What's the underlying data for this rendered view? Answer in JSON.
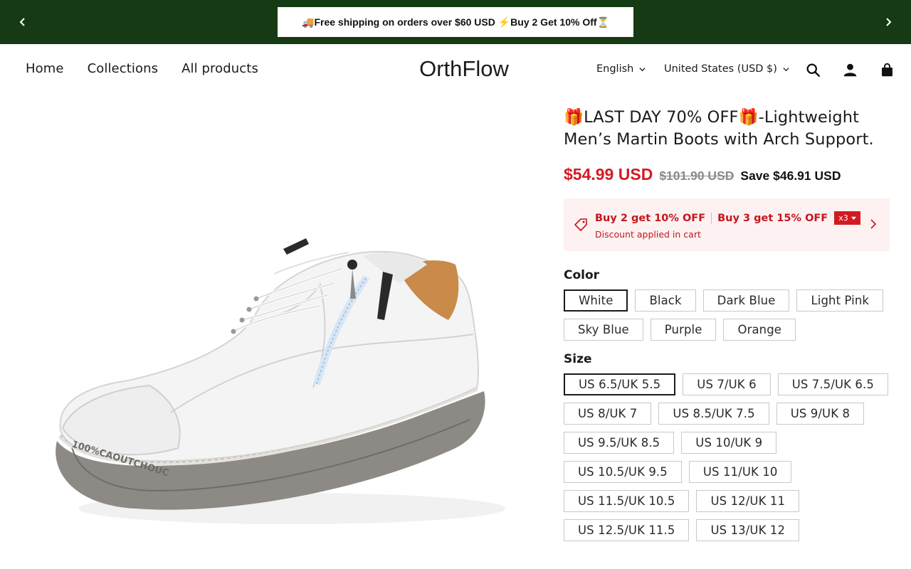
{
  "announcement": {
    "message": "🚚Free shipping on orders over $60 USD ⚡Buy 2 Get 10% Off⏳",
    "prev_icon": "chevron-left-icon",
    "next_icon": "chevron-right-icon",
    "bar_color": "#153a14"
  },
  "header": {
    "nav": [
      "Home",
      "Collections",
      "All products"
    ],
    "logo": "OrthFlow",
    "language": "English",
    "country": "United States (USD $)",
    "icons": [
      "search-icon",
      "account-icon",
      "cart-icon"
    ]
  },
  "product": {
    "title": "🎁LAST DAY 70% OFF🎁-Lightweight Men’s Martin Boots with Arch Support.",
    "price": "$54.99 USD",
    "compare_price": "$101.90 USD",
    "savings": "Save $46.91 USD",
    "promo": {
      "offer_1": "Buy 2 get 10% OFF",
      "offer_2": "Buy 3 get 15% OFF",
      "quantity_badge": "x3",
      "note": "Discount applied in cart"
    },
    "color_label": "Color",
    "colors": [
      "White",
      "Black",
      "Dark Blue",
      "Light Pink",
      "Sky Blue",
      "Purple",
      "Orange"
    ],
    "selected_color": "White",
    "size_label": "Size",
    "sizes": [
      "US 6.5/UK 5.5",
      "US 7/UK 6",
      "US 7.5/UK 6.5",
      "US 8/UK 7",
      "US 8.5/UK 7.5",
      "US 9/UK 8",
      "US 9.5/UK 8.5",
      "US 10/UK 9",
      "US 10.5/UK 9.5",
      "US 11/UK 10",
      "US 11.5/UK 10.5",
      "US 12/UK 11",
      "US 12.5/UK 11.5",
      "US 13/UK 12"
    ],
    "selected_size": "US 6.5/UK 5.5",
    "sole_text": "100%CAOUTCHOUC",
    "colors_hex": {
      "sale": "#d51a24",
      "promo_bg": "#fdf2f1"
    }
  }
}
